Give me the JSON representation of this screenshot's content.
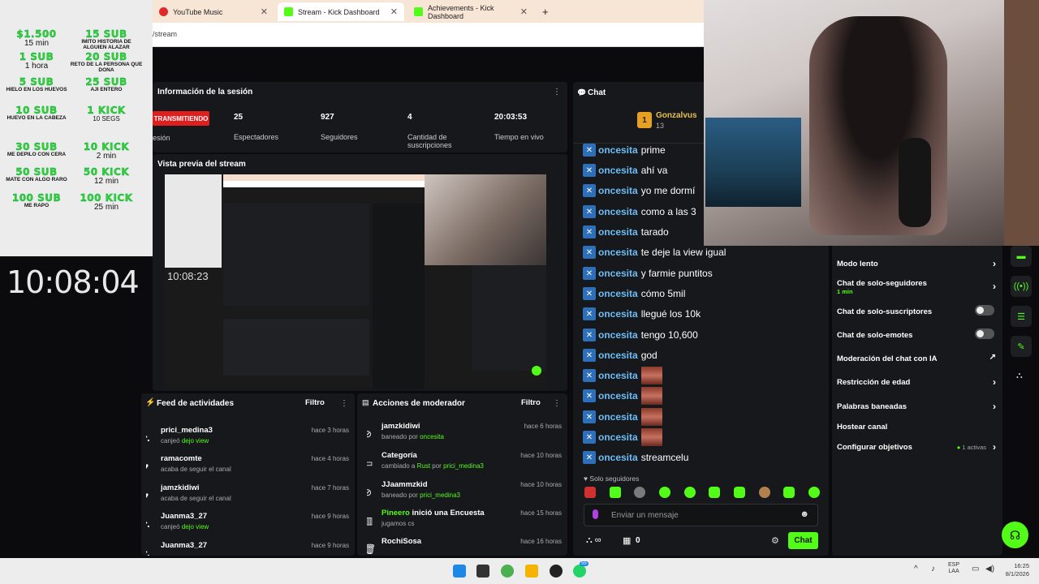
{
  "browser": {
    "tabs": [
      {
        "label": "YouTube Music",
        "icon": "youtube-music-icon",
        "color": "#e02a2a"
      },
      {
        "label": "Stream - Kick Dashboard",
        "icon": "kick-icon",
        "color": "#53fc18"
      },
      {
        "label": "Achievements - Kick Dashboard",
        "icon": "kick-icon",
        "color": "#53fc18"
      }
    ],
    "url": "/stream"
  },
  "goals": [
    {
      "title": "$1.500",
      "desc": "15 min",
      "big": true
    },
    {
      "title": "15 SUB",
      "desc": "imito historia de alguien alazar"
    },
    {
      "title": "1 SUB",
      "desc": "1 hora",
      "big": true
    },
    {
      "title": "20 SUB",
      "desc": "reto de la persona que dona"
    },
    {
      "title": "5 SUB",
      "desc": "hielo en los huevos"
    },
    {
      "title": "25 SUB",
      "desc": "aji entero"
    },
    {
      "title": "10 SUB",
      "desc": "huevo en la cabeza"
    },
    {
      "title": "1 KICK",
      "desc": "10 SEGS",
      "big": true
    },
    {
      "title": "30 SUB",
      "desc": "me depilo con cera"
    },
    {
      "title": "10 KICK",
      "desc": "2 min",
      "big": true
    },
    {
      "title": "50 SUB",
      "desc": "mate con algo raro"
    },
    {
      "title": "50 KICK",
      "desc": "12 min",
      "big": true
    },
    {
      "title": "100 SUB",
      "desc": "me rapo"
    },
    {
      "title": "100 KICK",
      "desc": "25 min",
      "big": true
    }
  ],
  "clock": "10:08:04",
  "session": {
    "title": "Información de la sesión",
    "live": "TRANSMITIENDO",
    "session_label": "esión",
    "stats": [
      {
        "value": "25",
        "label": "Espectadores"
      },
      {
        "value": "927",
        "label": "Seguidores"
      },
      {
        "value": "4",
        "label": "Cantidad de suscripciones"
      },
      {
        "value": "20:03:53",
        "label": "Tiempo en vivo"
      }
    ]
  },
  "preview": {
    "title": "Vista previa del stream",
    "clock": "10:08:23"
  },
  "feed": {
    "title": "Feed de actividades",
    "filter": "Filtro",
    "items": [
      {
        "name": "prici_medina3",
        "sub": "canjeó",
        "highlight": "dejo view",
        "time": "hace 3 horas",
        "icon": "redeem-icon"
      },
      {
        "name": "ramacomte",
        "sub": "acaba de seguir el canal",
        "highlight": "",
        "time": "hace 4 horas",
        "icon": "heart-icon"
      },
      {
        "name": "jamzkidiwi",
        "sub": "acaba de seguir el canal",
        "highlight": "",
        "time": "hace 7 horas",
        "icon": "heart-icon"
      },
      {
        "name": "Juanma3_27",
        "sub": "canjeó",
        "highlight": "dejo view",
        "time": "hace 9 horas",
        "icon": "redeem-icon"
      },
      {
        "name": "Juanma3_27",
        "sub": "",
        "highlight": "",
        "time": "hace 9 horas",
        "icon": "redeem-icon"
      }
    ]
  },
  "modactions": {
    "title": "Acciones de moderador",
    "filter": "Filtro",
    "items": [
      {
        "name": "jamzkidiwi",
        "sub": "baneado por",
        "highlight": "oncesita",
        "time": "hace 6 horas",
        "icon": "ban-icon"
      },
      {
        "name": "Categoría",
        "sub": "cambiado a",
        "highlight": "Rust",
        "extra": "por",
        "highlight2": "prici_medina3",
        "time": "hace 10 horas",
        "icon": "category-icon"
      },
      {
        "name": "JJaammzkid",
        "sub": "baneado por",
        "highlight": "prici_medina3",
        "time": "hace 10 horas",
        "icon": "ban-icon"
      },
      {
        "name": "Pineero",
        "namegreen": true,
        "name_rest": "inició una Encuesta",
        "sub": "jugamos cs",
        "highlight": "",
        "time": "hace 15 horas",
        "icon": "poll-icon"
      },
      {
        "name": "RochiSosa",
        "sub": "",
        "highlight": "",
        "time": "hace 16 horas",
        "icon": "trash-icon"
      }
    ]
  },
  "chat": {
    "title": "Chat",
    "top_user": "Gonzalvus",
    "top_count": "13",
    "messages": [
      {
        "user": "oncesita",
        "text": "prime"
      },
      {
        "user": "oncesita",
        "text": "ahí va"
      },
      {
        "user": "oncesita",
        "text": "yo me dormí"
      },
      {
        "user": "oncesita",
        "text": "como a las 3"
      },
      {
        "user": "oncesita",
        "text": "tarado"
      },
      {
        "user": "oncesita",
        "text": "te deje la view igual"
      },
      {
        "user": "oncesita",
        "text": "y farmie puntitos"
      },
      {
        "user": "oncesita",
        "text": "cómo 5mil"
      },
      {
        "user": "oncesita",
        "text": "llegué los 10k"
      },
      {
        "user": "oncesita",
        "text": "tengo 10,600"
      },
      {
        "user": "oncesita",
        "text": "god"
      },
      {
        "user": "oncesita",
        "text": "",
        "emote": true
      },
      {
        "user": "oncesita",
        "text": "",
        "emote": true
      },
      {
        "user": "oncesita",
        "text": "",
        "emote": true
      },
      {
        "user": "oncesita",
        "text": "",
        "emote": true
      },
      {
        "user": "oncesita",
        "text": "streamcelu"
      }
    ],
    "followers_only": "Solo seguidores",
    "placeholder": "Enviar un mensaje",
    "points": "0",
    "send": "Chat"
  },
  "settings": [
    {
      "label": "Modo lento",
      "type": "chevron"
    },
    {
      "label": "Chat de solo-seguidores",
      "type": "chevron",
      "sub": "1 min"
    },
    {
      "label": "Chat de solo-suscriptores",
      "type": "toggle"
    },
    {
      "label": "Chat de solo-emotes",
      "type": "toggle"
    },
    {
      "label": "Moderación del chat con IA",
      "type": "external"
    },
    {
      "label": "Restricción de edad",
      "type": "chevron"
    },
    {
      "label": "Palabras baneadas",
      "type": "chevron"
    },
    {
      "label": "Hostear canal",
      "type": "none"
    },
    {
      "label": "Configurar objetivos",
      "type": "chevron",
      "badge": "1 activas"
    }
  ],
  "taskbar": {
    "lang": "ESP",
    "lang2": "LAA",
    "time": "16:25",
    "date": "8/1/2026",
    "badge": "55"
  }
}
